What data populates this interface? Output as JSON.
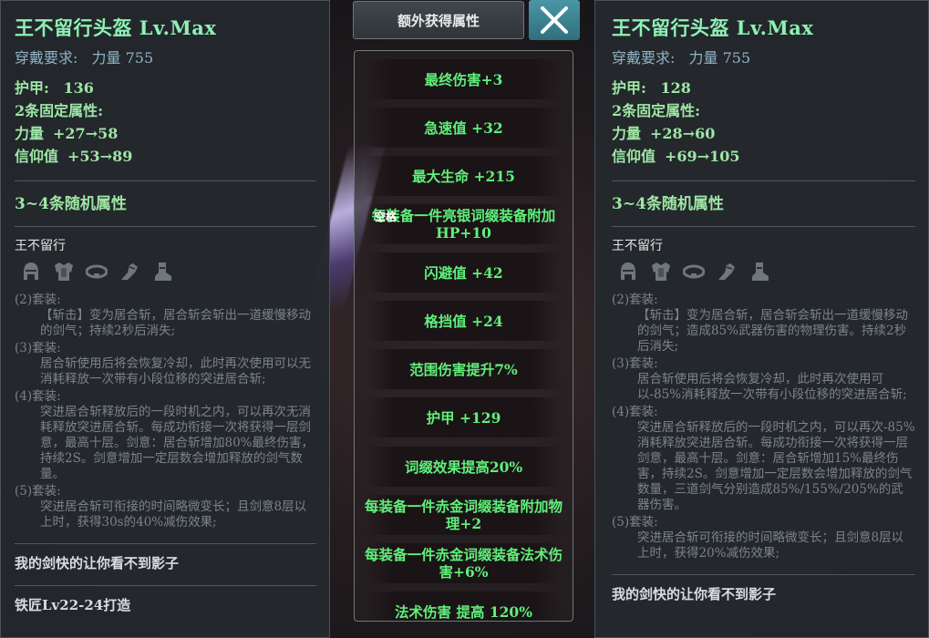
{
  "left": {
    "title": "王不留行头盔 Lv.Max",
    "requirement_label": "穿戴要求:",
    "requirement_value": "力量 755",
    "armor_label": "护甲:",
    "armor_value": "136",
    "fixed_label": "2条固定属性:",
    "fixed": [
      {
        "name": "力量",
        "value": "+27→58"
      },
      {
        "name": "信仰值",
        "value": "+53→89"
      }
    ],
    "random_label": "3~4条随机属性",
    "set_name": "王不留行",
    "set_bonuses": [
      {
        "label": "(2)套装:",
        "desc": "【斩击】变为居合斩，居合斩会斩出一道缓慢移动的剑气；持续2秒后消失;"
      },
      {
        "label": "(3)套装:",
        "desc": "居合斩使用后将会恢复冷却，此时再次使用可以无消耗释放一次带有小段位移的突进居合斩;"
      },
      {
        "label": "(4)套装:",
        "desc": "突进居合斩释放后的一段时机之内，可以再次无消耗释放突进居合斩。每成功衔接一次将获得一层剑意，最高十层。剑意：居合斩增加80%最终伤害，持续2S。剑意增加一定层数会增加释放的剑气数量。"
      },
      {
        "label": "(5)套装:",
        "desc": "突进居合斩可衔接的时间略微变长；且剑意8层以上时，获得30s的40%减伤效果;"
      }
    ],
    "flavor": "我的剑快的让你看不到影子",
    "smith": "铁匠Lv22-24打造"
  },
  "right": {
    "title": "王不留行头盔 Lv.Max",
    "requirement_label": "穿戴要求:",
    "requirement_value": "力量 755",
    "armor_label": "护甲:",
    "armor_value": "128",
    "fixed_label": "2条固定属性:",
    "fixed": [
      {
        "name": "力量",
        "value": "+28→60"
      },
      {
        "name": "信仰值",
        "value": "+69→105"
      }
    ],
    "random_label": "3~4条随机属性",
    "set_name": "王不留行",
    "set_bonuses": [
      {
        "label": "(2)套装:",
        "desc": "【斩击】变为居合斩，居合斩会斩出一道缓慢移动的剑气；造成85%武器伤害的物理伤害。持续2秒后消失;"
      },
      {
        "label": "(3)套装:",
        "desc": "居合斩使用后将会恢复冷却，此时再次使用可以-85%消耗释放一次带有小段位移的突进居合斩;"
      },
      {
        "label": "(4)套装:",
        "desc": "突进居合斩释放后的一段时机之内，可以再次-85%消耗释放突进居合斩。每成功衔接一次将获得一层剑意，最高十层。剑意：居合斩增加15%最终伤害，持续2S。剑意增加一定层数会增加释放的剑气数量，三道剑气分别造成85%/155%/205%的武器伤害。"
      },
      {
        "label": "(5)套装:",
        "desc": "突进居合斩可衔接的时间略微变长；且剑意8层以上时，获得20%减伤效果;"
      }
    ],
    "flavor": "我的剑快的让你看不到影子"
  },
  "center": {
    "header": "额外获得属性",
    "hint": "空格",
    "options": [
      "最终伤害+3",
      "急速值 +32",
      "最大生命 +215",
      "每装备一件亮银词缀装备附加HP+10",
      "闪避值 +42",
      "格挡值 +24",
      "范围伤害提升7%",
      "护甲 +129",
      "词缀效果提高20%",
      "每装备一件赤金词缀装备附加物理+2",
      "每装备一件赤金词缀装备法术伤害+6%",
      "法术伤害 提高 120%"
    ]
  },
  "icons": [
    "helmet-icon",
    "chest-armor-icon",
    "belt-icon",
    "gauntlet-icon",
    "boots-icon"
  ],
  "colors": {
    "title": "#8ef0b5",
    "attribute": "#9ee6a5",
    "option_text": "#5ff07a",
    "close_button": "#3f8796"
  }
}
